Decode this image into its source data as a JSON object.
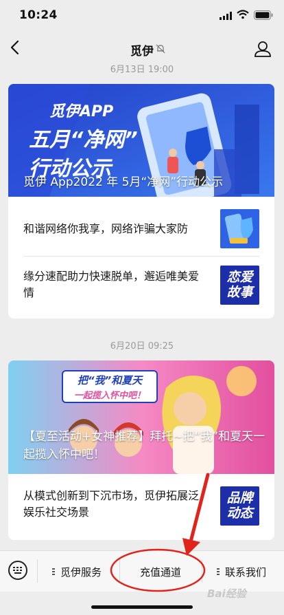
{
  "status": {
    "time": "10:24"
  },
  "nav": {
    "title": "觅伊"
  },
  "messages": [
    {
      "date": "6月13日 19:00",
      "hero": {
        "banner_app": "觅伊APP",
        "banner_line1": "五月“净网”",
        "banner_line2": "行动公示",
        "title": "觅伊 App2022 年 5月“净网”行动公示"
      },
      "items": [
        {
          "text": "和谐网络你我享，网络诈骗大家防"
        },
        {
          "text": "缘分速配助力快速脱单，邂逅唯美爱情",
          "thumb_text": "恋爱故事"
        }
      ]
    },
    {
      "date": "6月20日 09:25",
      "hero": {
        "banner_badge_line1": "把“我”和夏天",
        "banner_badge_line2": "一起揽入怀中吧！",
        "title": "【夏至活动+女神推荐】拜托~把“我”和夏天一起揽入怀中吧！"
      },
      "items": [
        {
          "text": "从模式创新到下沉市场，觅伊拓展泛娱乐社交场景",
          "thumb_text": "品牌动态"
        }
      ]
    }
  ],
  "menu": [
    {
      "label": "觅伊服务"
    },
    {
      "label": "充值通道"
    },
    {
      "label": "联系我们"
    }
  ],
  "watermark": "Bai经验",
  "colors": {
    "annotation": "#e0241b",
    "hero1_bg": "#2b4fd6",
    "hero2_bg": "#e85aa6"
  }
}
